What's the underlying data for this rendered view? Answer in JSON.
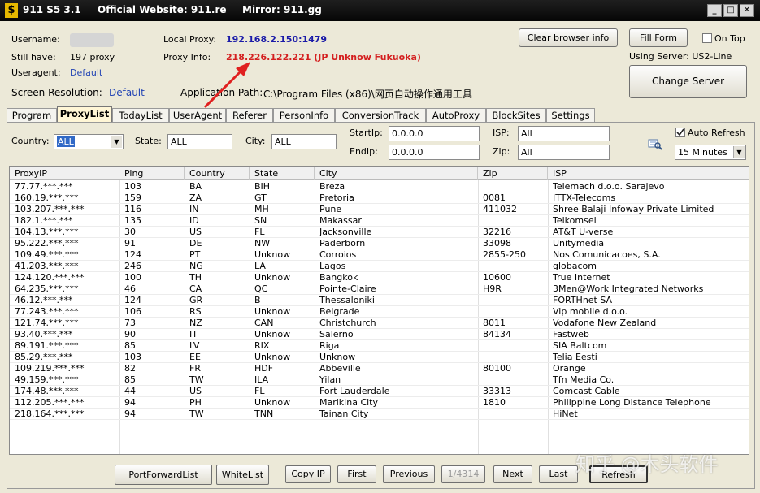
{
  "titlebar": {
    "app": "911 S5 3.1",
    "website": "Official Website:  911.re",
    "mirror": "Mirror:  911.gg",
    "logo_glyph": "$",
    "minimize": "_",
    "maximize": "□",
    "close": "✕"
  },
  "info": {
    "username_label": "Username:",
    "still_have_label": "Still have:",
    "still_have_value": "197  proxy",
    "useragent_label": "Useragent:",
    "useragent_value": "Default",
    "local_proxy_label": "Local Proxy:",
    "local_proxy_value": "192.168.2.150:1479",
    "proxy_info_label": "Proxy Info:",
    "proxy_info_value": "218.226.122.221 (JP Unknow Fukuoka)",
    "screen_res_label": "Screen Resolution:",
    "screen_res_value": "Default",
    "app_path_label": "Application Path:",
    "app_path_value": "C:\\Program Files (x86)\\网页自动操作通用工具",
    "clear_browser": "Clear browser info",
    "fill_form": "Fill Form",
    "on_top": "On Top",
    "using_server": "Using Server: US2-Line",
    "change_server": "Change Server"
  },
  "tabs": [
    "Program",
    "ProxyList",
    "TodayList",
    "UserAgent",
    "Referer",
    "PersonInfo",
    "ConversionTrack",
    "AutoProxy",
    "BlockSites",
    "Settings"
  ],
  "filters": {
    "country_label": "Country:",
    "country_value": "ALL",
    "state_label": "State:",
    "state_value": "ALL",
    "city_label": "City:",
    "city_value": "ALL",
    "startip_label": "StartIp:",
    "startip_value": "0.0.0.0",
    "endip_label": "EndIp:",
    "endip_value": "0.0.0.0",
    "isp_label": "ISP:",
    "isp_value": "All",
    "zip_label": "Zip:",
    "zip_value": "All",
    "auto_refresh": "Auto Refresh",
    "interval": "15 Minutes"
  },
  "table": {
    "columns": [
      "ProxyIP",
      "Ping",
      "Country",
      "State",
      "City",
      "Zip",
      "ISP"
    ],
    "rows": [
      [
        "77.77.***.***",
        "103",
        "BA",
        "BIH",
        "Breza",
        "",
        "Telemach d.o.o. Sarajevo"
      ],
      [
        "160.19.***.***",
        "159",
        "ZA",
        "GT",
        "Pretoria",
        "0081",
        "ITTX-Telecoms"
      ],
      [
        "103.207.***.***",
        "116",
        "IN",
        "MH",
        "Pune",
        "411032",
        "Shree Balaji Infoway Private Limited"
      ],
      [
        "182.1.***.***",
        "135",
        "ID",
        "SN",
        "Makassar",
        "",
        "Telkomsel"
      ],
      [
        "104.13.***.***",
        "30",
        "US",
        "FL",
        "Jacksonville",
        "32216",
        "AT&T U-verse"
      ],
      [
        "95.222.***.***",
        "91",
        "DE",
        "NW",
        "Paderborn",
        "33098",
        "Unitymedia"
      ],
      [
        "109.49.***.***",
        "124",
        "PT",
        "Unknow",
        "Corroios",
        "2855-250",
        "Nos Comunicacoes, S.A."
      ],
      [
        "41.203.***.***",
        "246",
        "NG",
        "LA",
        "Lagos",
        "",
        "globacom"
      ],
      [
        "124.120.***.***",
        "100",
        "TH",
        "Unknow",
        "Bangkok",
        "10600",
        "True Internet"
      ],
      [
        "64.235.***.***",
        "46",
        "CA",
        "QC",
        "Pointe-Claire",
        "H9R",
        "3Men@Work Integrated Networks"
      ],
      [
        "46.12.***.***",
        "124",
        "GR",
        "B",
        "Thessaloniki",
        "",
        "FORTHnet SA"
      ],
      [
        "77.243.***.***",
        "106",
        "RS",
        "Unknow",
        "Belgrade",
        "",
        "Vip mobile d.o.o."
      ],
      [
        "121.74.***.***",
        "73",
        "NZ",
        "CAN",
        "Christchurch",
        "8011",
        "Vodafone New Zealand"
      ],
      [
        "93.40.***.***",
        "90",
        "IT",
        "Unknow",
        "Salerno",
        "84134",
        "Fastweb"
      ],
      [
        "89.191.***.***",
        "85",
        "LV",
        "RIX",
        "Riga",
        "",
        "SIA Baltcom"
      ],
      [
        "85.29.***.***",
        "103",
        "EE",
        "Unknow",
        "Unknow",
        "",
        "Telia Eesti"
      ],
      [
        "109.219.***.***",
        "82",
        "FR",
        "HDF",
        "Abbeville",
        "80100",
        "Orange"
      ],
      [
        "49.159.***.***",
        "85",
        "TW",
        "ILA",
        "Yilan",
        "",
        "Tfn Media Co."
      ],
      [
        "174.48.***.***",
        "44",
        "US",
        "FL",
        "Fort Lauderdale",
        "33313",
        "Comcast Cable"
      ],
      [
        "112.205.***.***",
        "94",
        "PH",
        "Unknow",
        "Marikina City",
        "1810",
        "Philippine Long Distance Telephone"
      ],
      [
        "218.164.***.***",
        "94",
        "TW",
        "TNN",
        "Tainan City",
        "",
        "HiNet"
      ]
    ]
  },
  "bottom": {
    "port_forward": "PortForwardList",
    "whitelist": "WhiteList",
    "copy_ip": "Copy IP",
    "first": "First",
    "previous": "Previous",
    "page": "1/4314",
    "next": "Next",
    "last": "Last",
    "refresh": "Refresh"
  },
  "watermark": "知乎 @木头软件",
  "colors": {
    "accent_blue": "#2143b4",
    "proxy_red": "#d42020",
    "active_tab": "#fff6d6"
  }
}
